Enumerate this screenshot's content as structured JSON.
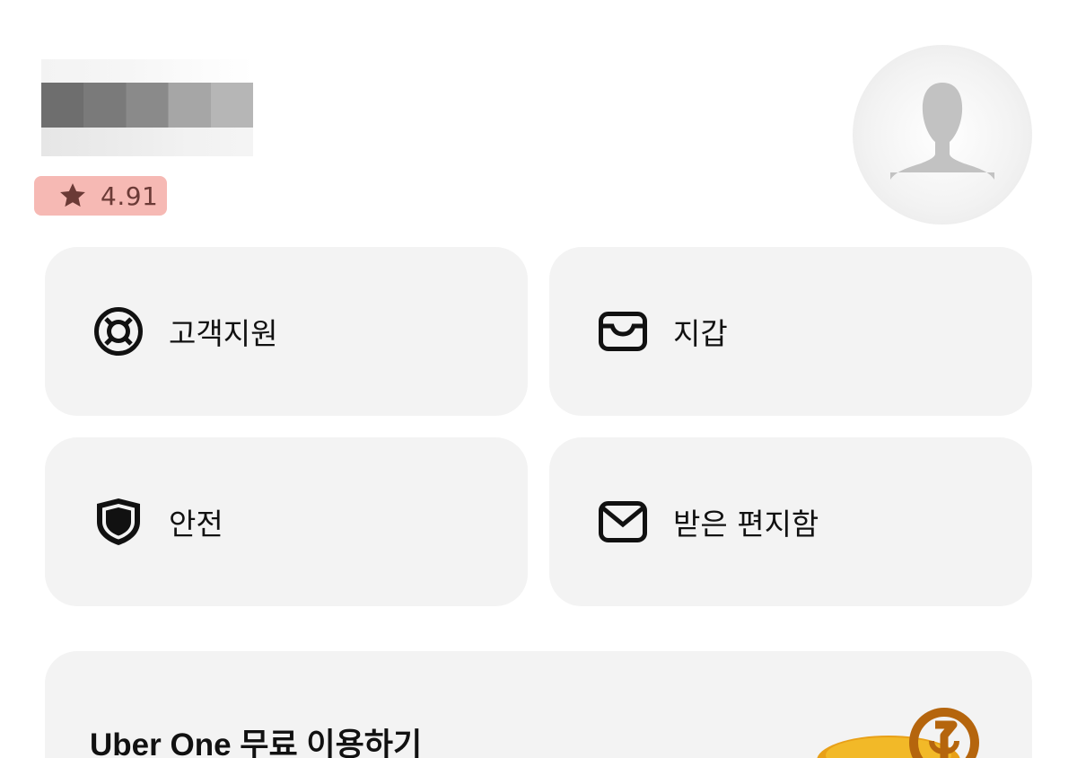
{
  "header": {
    "user_name": "",
    "rating": "4.91",
    "rating_highlight_color": "#f6b9b4",
    "icons": {
      "rating": "star-icon",
      "avatar": "person-silhouette-icon"
    }
  },
  "tiles": [
    {
      "id": "support",
      "label": "고객지원",
      "icon": "lifebuoy-icon"
    },
    {
      "id": "wallet",
      "label": "지갑",
      "icon": "wallet-icon"
    },
    {
      "id": "safety",
      "label": "안전",
      "icon": "shield-icon"
    },
    {
      "id": "inbox",
      "label": "받은 편지함",
      "icon": "envelope-icon"
    }
  ],
  "promo": {
    "title": "Uber One 무료 이용하기",
    "art_icon": "uber-one-illustration-icon",
    "accent": "#e8a018"
  }
}
